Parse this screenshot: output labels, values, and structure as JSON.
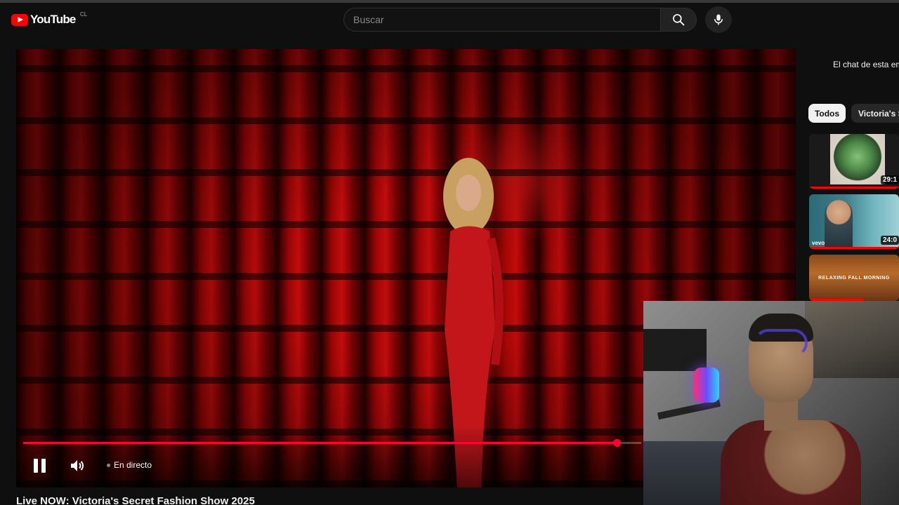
{
  "header": {
    "logo_text": "YouTube",
    "region": "CL",
    "search_placeholder": "Buscar"
  },
  "player": {
    "progress": 0.96,
    "status": "En directo",
    "title": "Live NOW: Victoria's Secret Fashion Show 2025",
    "accent_color": "#ff0033"
  },
  "sidebar": {
    "chat_note": "El chat de esta em",
    "chips": [
      "Todos",
      "Victoria's Se"
    ],
    "videos": [
      {
        "duration": "29:1",
        "watched": 1.0
      },
      {
        "duration": "24:0",
        "badge": "vevo",
        "watched": 1.0
      },
      {
        "title_text": "RELAXING FALL MORNING",
        "watched": 0.6
      }
    ]
  },
  "icons": [
    "youtube-logo-icon",
    "search-icon",
    "microphone-icon",
    "pause-icon",
    "volume-icon"
  ]
}
